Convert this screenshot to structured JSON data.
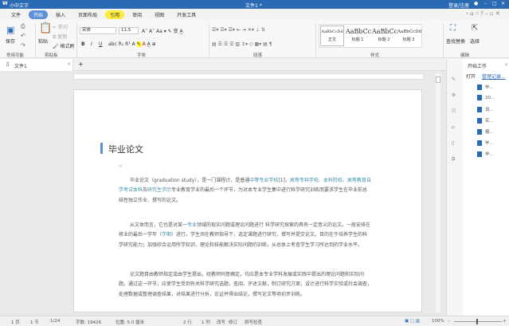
{
  "app": {
    "name": "小中文字",
    "doc_title": "文件1 *",
    "user": "登录/注册"
  },
  "menu": [
    "文件",
    "开始",
    "插入",
    "页面布局",
    "引用",
    "审阅",
    "视图",
    "开发工具"
  ],
  "ribbon": {
    "common": {
      "save": "保存",
      "label": "常用功能"
    },
    "clipboard": {
      "paste": "粘贴",
      "cut": "剪切",
      "copy": "复制",
      "format_painter": "格式刷",
      "label": "剪贴板"
    },
    "font": {
      "name": "宋体",
      "size": "11.5",
      "bold": "B",
      "italic": "I",
      "underline": "U",
      "label": "字体"
    },
    "paragraph": {
      "label": "段落"
    },
    "styles": {
      "items": [
        {
          "sample": "AaBbCcDd",
          "name": "正文"
        },
        {
          "sample": "AaBbCc",
          "name": "标题 1"
        },
        {
          "sample": "AaBbCc",
          "name": "标题 2"
        },
        {
          "sample": "AaBbCcDd",
          "name": "标题 3"
        }
      ],
      "label": "样式"
    },
    "editing": {
      "find_replace": "查找替换",
      "select": "选择",
      "label": "编辑"
    }
  },
  "doc_tab": {
    "name": "文件1",
    "add": "+"
  },
  "document": {
    "heading": "毕业论文",
    "paragraphs": [
      [
        "毕业论文（graduation study），是一门课程计，是普通",
        "中等专业学校",
        "[1]，",
        "高等专科学校、本科院校、高等教育自学考试本科",
        "及",
        "研究生学历",
        "专业教育学业的最后一个环节，为对本专业学生集中进行科学研究训练而要求学生在毕业前总结性独立作业、撰写的论文。"
      ],
      [
        "从文体而言，它也是对某一",
        "专业",
        "领域的现实问题或理论问题进行 科学研究探索的具有一定意义的论文。一般安排在修业的最后一学年（",
        "学期",
        "）进行。学生须在教师指导下，选定课题进行研究，撰写并提交论文。目的在于培养学生的科学研究能力；加强综合运用所学知识、理论和技能解决实际问题的训练，从总体上考查学生学习所达到的学业水平。"
      ],
      [
        "论文题目由教师指定或由学生提出，经教师同意确定。均应是本专业学科发展或实践中提出的理论问题和实际问题。通过这一环节，应使学生受到有关科学研究选题，查阅、评述文献，制订研究方案，设计进行科学实验或社会调查，处理数据或整理调查结果，对结果进行分析，论证并得出结论，撰写论文等项初步训练。"
      ]
    ]
  },
  "side_panel": {
    "title": "开始工作",
    "open": "打开",
    "manage": "管理记录...",
    "files": [
      "毕...",
      "20...",
      "设...",
      "实...",
      "格...",
      "毕...",
      "毕..."
    ]
  },
  "status": {
    "page": "1 页",
    "section": "1 节",
    "pages": "1/24",
    "words": "字数: 19426",
    "position": "位置: 5.0 厘米",
    "line": "2 行",
    "col": "1 列",
    "overwrite": "改写",
    "revise": "修订",
    "spell": "拼写检查",
    "zoom": "100%"
  }
}
